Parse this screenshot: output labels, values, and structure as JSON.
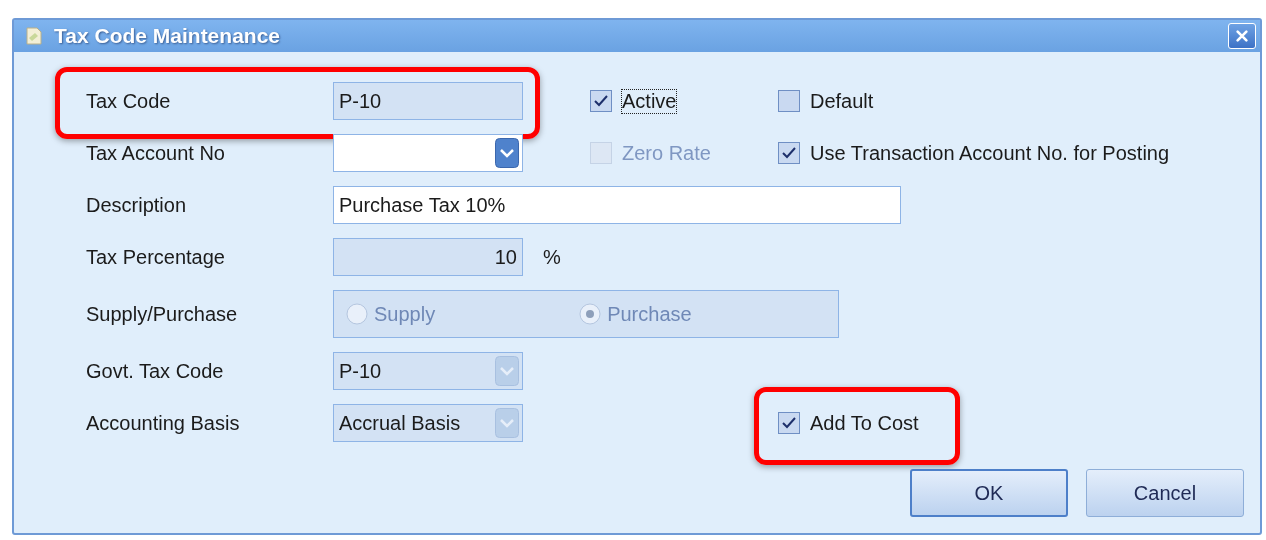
{
  "window": {
    "title": "Tax Code Maintenance"
  },
  "fields": [
    {
      "label": "Tax Code",
      "kind": "text",
      "value": "P-10",
      "disabled": true,
      "highlighted": true
    },
    {
      "label": "Tax Account No",
      "kind": "combo",
      "disabled": false,
      "highlighted": false
    },
    {
      "label": "Description",
      "kind": "long-text",
      "value": "Purchase Tax 10%",
      "disabled": false,
      "highlighted": false
    },
    {
      "label": "Tax Percentage",
      "kind": "number",
      "value": "10",
      "unit": "%",
      "disabled": true,
      "highlighted": false
    },
    {
      "label": "Supply/Purchase",
      "kind": "radio",
      "disabled": true,
      "highlighted": false,
      "options": [
        {
          "label": "Supply",
          "selected": false
        },
        {
          "label": "Purchase",
          "selected": true
        }
      ]
    },
    {
      "label": "Govt. Tax Code",
      "kind": "combo",
      "value": "P-10",
      "disabled": true,
      "highlighted": false
    },
    {
      "label": "Accounting Basis",
      "kind": "combo",
      "value": "Accrual Basis",
      "disabled": true,
      "highlighted": false
    }
  ],
  "checkboxes": [
    {
      "label": "Active",
      "checked": true,
      "disabled": false,
      "focused": true,
      "highlighted": false
    },
    {
      "label": "Default",
      "checked": false,
      "disabled": false,
      "focused": false,
      "highlighted": false
    },
    {
      "label": "Zero Rate",
      "checked": false,
      "disabled": true,
      "focused": false,
      "highlighted": false
    },
    {
      "label": "Use Transaction Account No. for Posting",
      "checked": true,
      "disabled": false,
      "focused": false,
      "highlighted": false
    },
    {
      "label": "Add To Cost",
      "checked": true,
      "disabled": false,
      "focused": false,
      "highlighted": true
    }
  ],
  "buttons": [
    {
      "label": "OK",
      "default": true
    },
    {
      "label": "Cancel",
      "default": false
    }
  ]
}
